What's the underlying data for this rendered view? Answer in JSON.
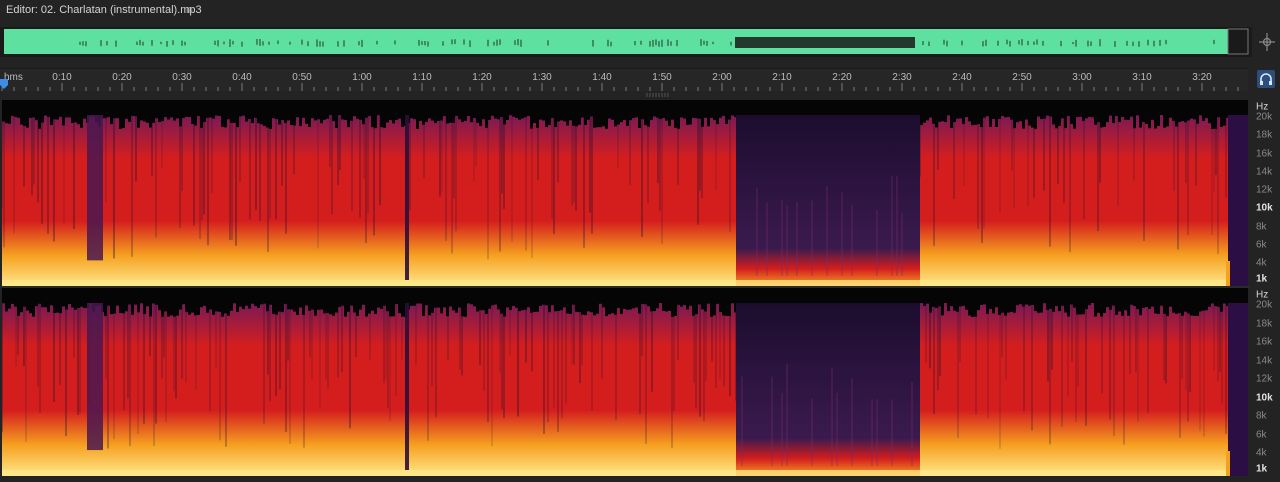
{
  "editor": {
    "title": "Editor: 02. Charlatan (instrumental).mp3",
    "menu_icon": "hamburger-menu-icon"
  },
  "overview": {
    "waveform_color": "#5de0a0",
    "zoom_icon": "zoom-navigator-icon"
  },
  "timeline": {
    "unit": "hms",
    "ticks": [
      "0:10",
      "0:20",
      "0:30",
      "0:40",
      "0:50",
      "1:00",
      "1:10",
      "1:20",
      "1:30",
      "1:40",
      "1:50",
      "2:00",
      "2:10",
      "2:20",
      "2:30",
      "2:40",
      "2:50",
      "3:00",
      "3:10",
      "3:20"
    ],
    "playhead_color": "#3a8ee6",
    "right_button_icon": "headphones-icon"
  },
  "spectral": {
    "unit": "Hz",
    "labels": [
      "20k",
      "18k",
      "16k",
      "14k",
      "12k",
      "10k",
      "8k",
      "6k",
      "4k",
      "1k"
    ],
    "emphasized": [
      "10k",
      "1k"
    ],
    "colors": {
      "low": "#1c0d2e",
      "mid": "#7a1a55",
      "high": "#d41e1e",
      "hot": "#f5a020",
      "peak": "#ffe88a"
    }
  }
}
